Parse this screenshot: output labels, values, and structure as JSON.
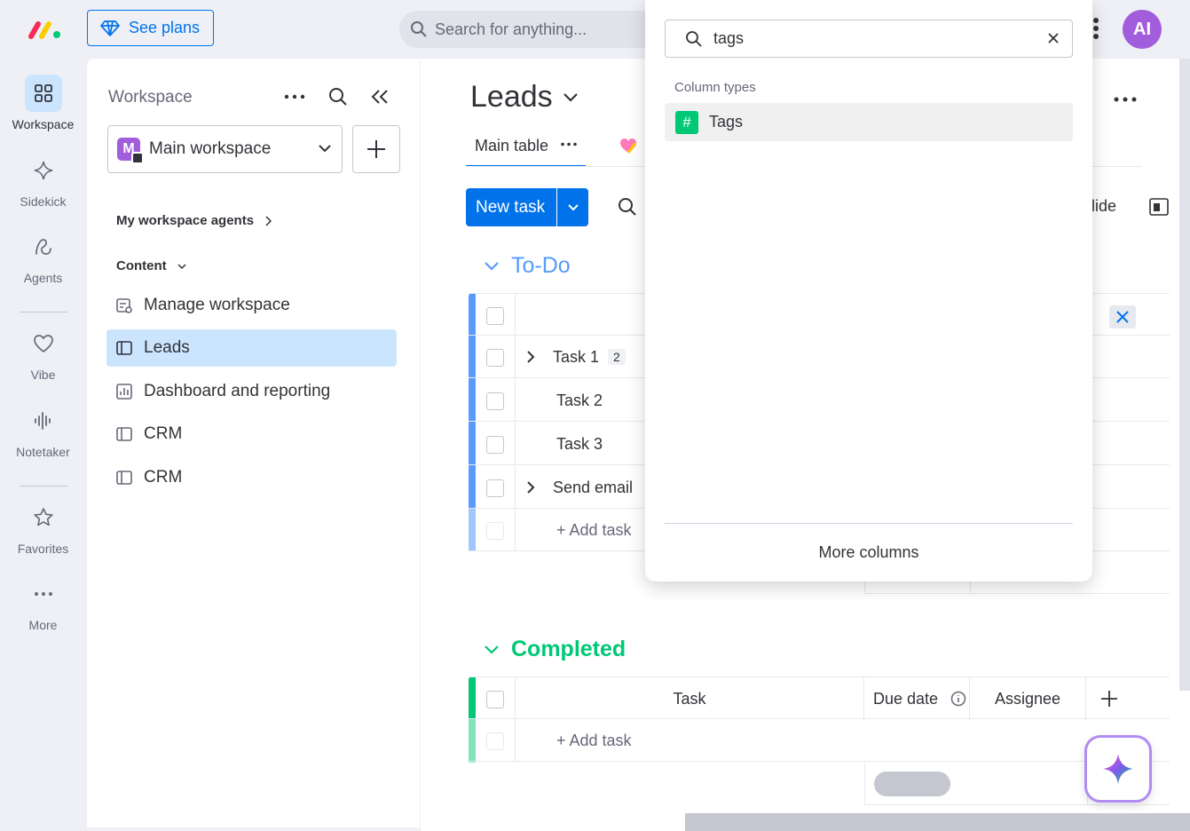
{
  "topbar": {
    "see_plans_label": "See plans",
    "search_placeholder": "Search for anything...",
    "avatar_initials": "AI"
  },
  "rail": {
    "items": [
      {
        "label": "Workspace"
      },
      {
        "label": "Sidekick"
      },
      {
        "label": "Agents"
      },
      {
        "label": "Vibe"
      },
      {
        "label": "Notetaker"
      },
      {
        "label": "Favorites"
      },
      {
        "label": "More"
      }
    ]
  },
  "workspace": {
    "title": "Workspace",
    "selected_workspace": "Main workspace",
    "workspace_badge": "M",
    "agents_link": "My workspace agents",
    "content_label": "Content",
    "nav_items": [
      {
        "label": "Manage workspace"
      },
      {
        "label": "Leads"
      },
      {
        "label": "Dashboard and reporting"
      },
      {
        "label": "CRM"
      },
      {
        "label": "CRM"
      }
    ]
  },
  "board": {
    "title": "Leads",
    "tab_main": "Main table",
    "new_task_label": "New task",
    "hide_partial": "lide",
    "groups": [
      {
        "title": "To-Do",
        "color": "#579bfc",
        "rows": [
          {
            "name": "Task 1",
            "subitems": "2"
          },
          {
            "name": "Task 2"
          },
          {
            "name": "Task 3"
          },
          {
            "name": "Send email"
          }
        ],
        "add_label": "+ Add task"
      },
      {
        "title": "Completed",
        "color": "#00c875",
        "columns": {
          "task": "Task",
          "due_date": "Due date",
          "assignee": "Assignee"
        },
        "add_label": "+ Add task"
      }
    ]
  },
  "popover": {
    "search_value": "tags",
    "section_label": "Column types",
    "options": [
      {
        "label": "Tags",
        "icon": "#",
        "icon_color": "#00c875"
      }
    ],
    "more_columns": "More columns"
  },
  "colors": {
    "primary": "#0073ea",
    "brand_purple": "#a25ddc",
    "selected_bg": "#cce5ff"
  }
}
